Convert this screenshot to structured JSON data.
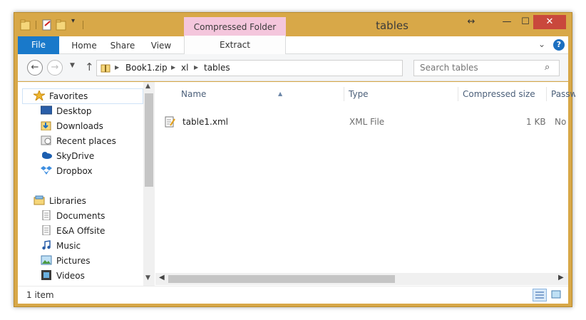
{
  "window": {
    "title": "tables",
    "contextual_tab_group": "Compressed Folder Tools",
    "caption_buttons": {
      "resize": "↔",
      "minimize": "—",
      "maximize": "☐",
      "close": "✕"
    }
  },
  "ribbon": {
    "tabs": [
      {
        "label": "File"
      },
      {
        "label": "Home"
      },
      {
        "label": "Share"
      },
      {
        "label": "View"
      },
      {
        "label": "Extract"
      }
    ],
    "help": "?"
  },
  "address": {
    "crumbs": [
      "Book1.zip",
      "xl",
      "tables"
    ]
  },
  "search": {
    "placeholder": "Search tables"
  },
  "navigation": {
    "favorites": {
      "label": "Favorites",
      "items": [
        "Desktop",
        "Downloads",
        "Recent places",
        "SkyDrive",
        "Dropbox"
      ]
    },
    "libraries": {
      "label": "Libraries",
      "items": [
        "Documents",
        "E&A Offsite",
        "Music",
        "Pictures",
        "Videos"
      ]
    }
  },
  "columns": [
    "Name",
    "Type",
    "Compressed size",
    "Passwor"
  ],
  "files": [
    {
      "name": "table1.xml",
      "type": "XML File",
      "compressed_size": "1 KB",
      "password": "No"
    }
  ],
  "status": {
    "count": "1 item"
  },
  "colors": {
    "frame": "#d8a848",
    "file_tab": "#1979ca",
    "context_tab": "#f4c6dc",
    "close": "#c9483c"
  }
}
